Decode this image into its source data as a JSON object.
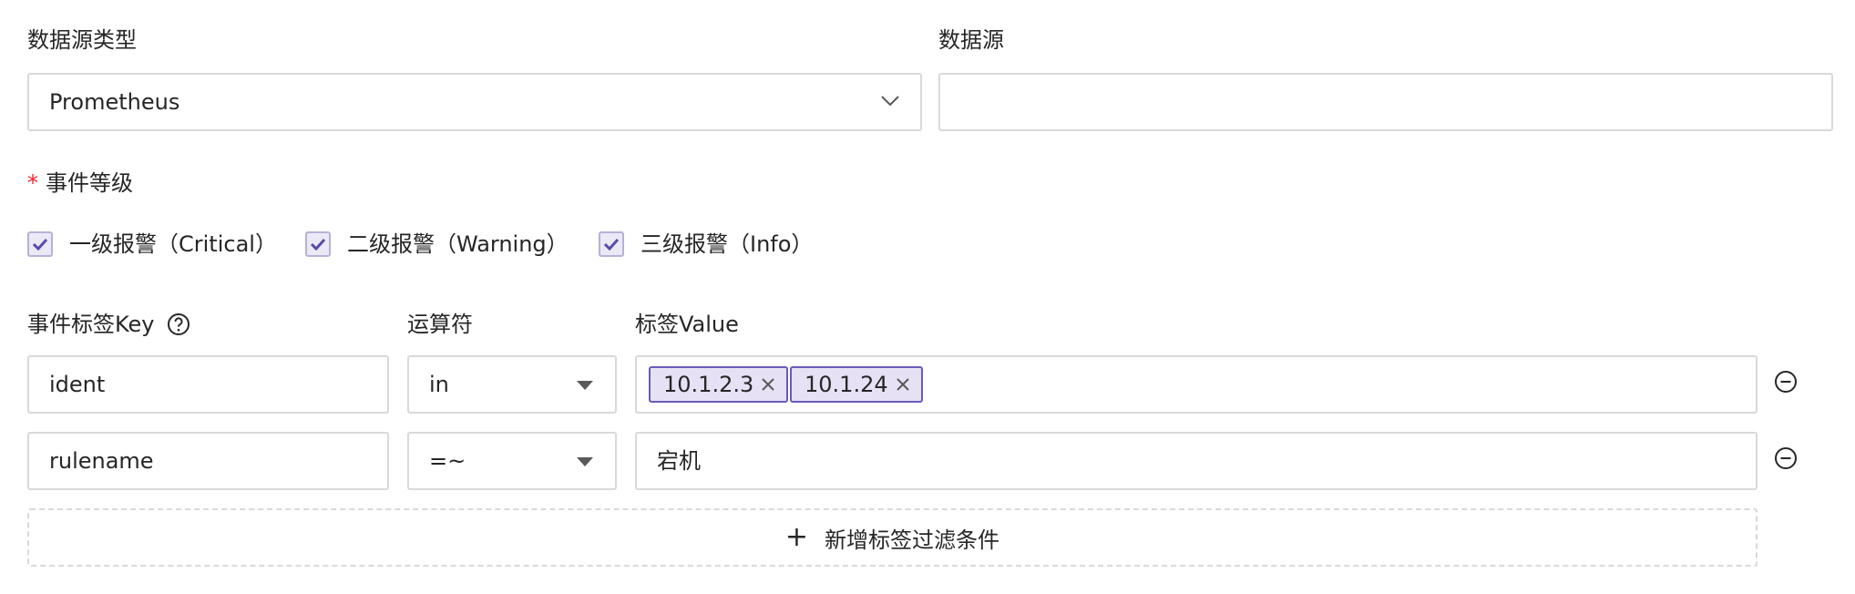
{
  "datasource_type": {
    "label": "数据源类型",
    "value": "Prometheus",
    "icon": "chevron-down-icon"
  },
  "datasource": {
    "label": "数据源",
    "value": ""
  },
  "event_level": {
    "required_mark": "*",
    "label": "事件等级",
    "options": [
      {
        "label": "一级报警（Critical）",
        "checked": true
      },
      {
        "label": "二级报警（Warning）",
        "checked": true
      },
      {
        "label": "三级报警（Info）",
        "checked": true
      }
    ]
  },
  "tag_filter": {
    "key_header": "事件标签Key",
    "help_icon": "question-circle-icon",
    "operator_header": "运算符",
    "value_header": "标签Value",
    "rows": [
      {
        "key": "ident",
        "operator": "in",
        "tags": [
          "10.1.2.3",
          "10.1.24"
        ],
        "value": ""
      },
      {
        "key": "rulename",
        "operator": "=~",
        "tags": [],
        "value": "宕机"
      }
    ],
    "remove_icon": "minus-circle-icon",
    "add_label": "新增标签过滤条件",
    "add_symbol": "+"
  },
  "colors": {
    "accent": "#6b5ab8",
    "required": "#f5222d",
    "border": "#d9d9d9",
    "checkbox_bg": "#ece9f6"
  }
}
